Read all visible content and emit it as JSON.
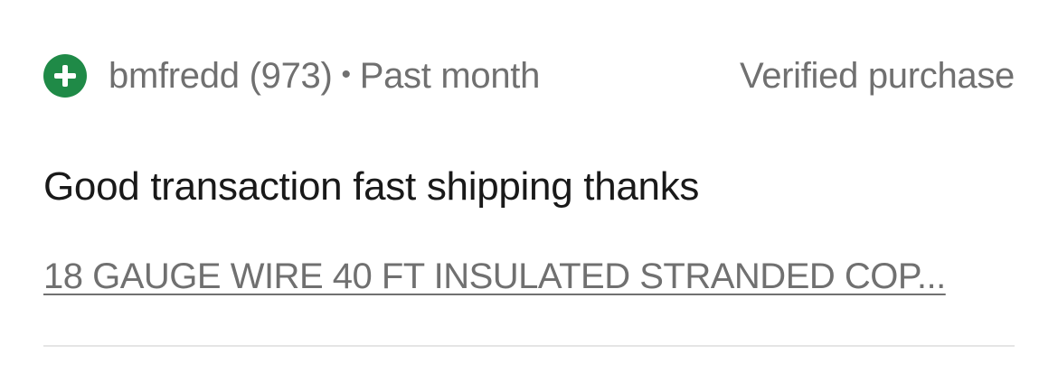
{
  "review": {
    "icon": "plus-circle-icon",
    "icon_color": "#1f8a47",
    "username": "bmfredd",
    "score": "(973)",
    "separator": "•",
    "time": "Past month",
    "verified_label": "Verified purchase",
    "comment": "Good transaction fast shipping thanks",
    "item_title": "18 GAUGE WIRE 40 FT INSULATED STRANDED COP..."
  }
}
